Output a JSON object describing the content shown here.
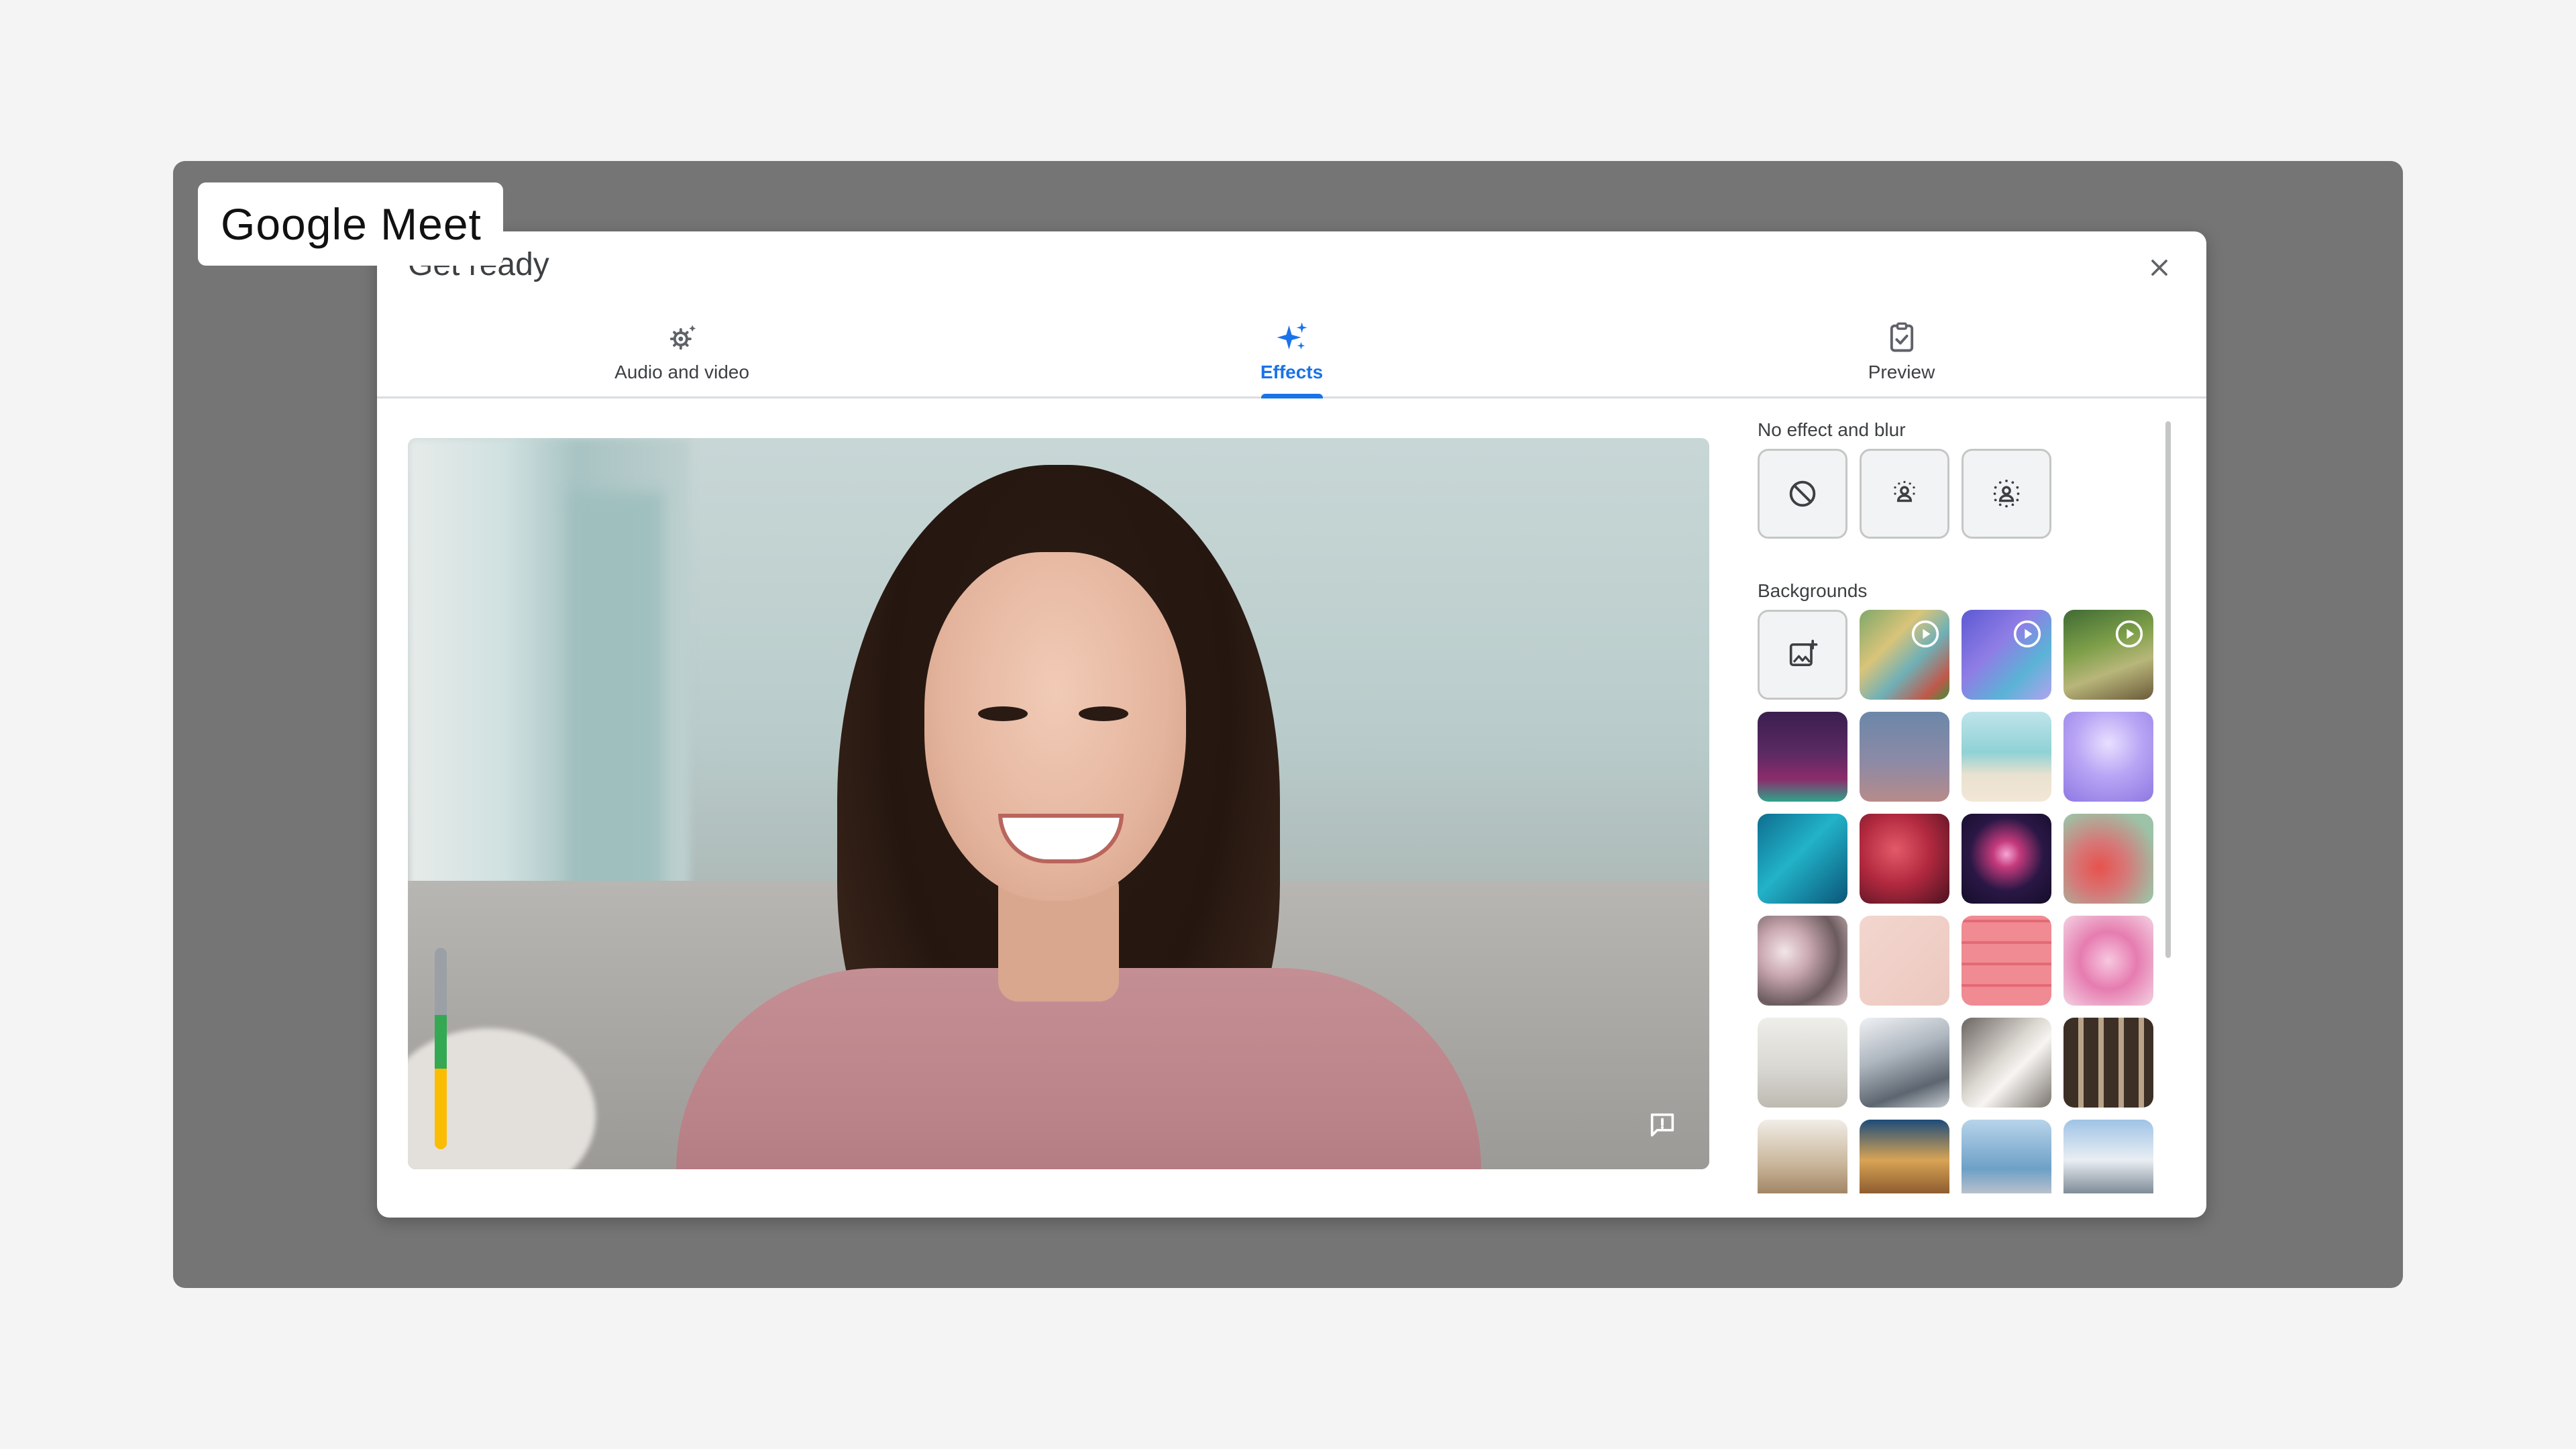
{
  "app_label": "Google Meet",
  "dialog": {
    "title": "Get ready",
    "close_icon": "close-icon"
  },
  "tabs": [
    {
      "label": "Audio and video",
      "icon": "audio-video-settings-icon",
      "active": false
    },
    {
      "label": "Effects",
      "icon": "sparkle-effects-icon",
      "active": true
    },
    {
      "label": "Preview",
      "icon": "clipboard-check-icon",
      "active": false
    }
  ],
  "panel": {
    "no_effect_title": "No effect and blur",
    "effects": [
      {
        "name": "no-effect",
        "icon": "no-effect-icon"
      },
      {
        "name": "slight-blur",
        "icon": "slight-blur-icon"
      },
      {
        "name": "blur",
        "icon": "blur-background-icon"
      }
    ],
    "backgrounds_title": "Backgrounds",
    "backgrounds": [
      {
        "name": "upload",
        "icon": "add-image-icon"
      },
      {
        "name": "animated-classroom",
        "video": true
      },
      {
        "name": "animated-purple-room",
        "video": true
      },
      {
        "name": "animated-forest",
        "video": true
      },
      {
        "name": "theater-stage"
      },
      {
        "name": "dusk-gradient"
      },
      {
        "name": "beach"
      },
      {
        "name": "purple-clouds"
      },
      {
        "name": "water"
      },
      {
        "name": "red-nebula"
      },
      {
        "name": "fireworks"
      },
      {
        "name": "flowers-red"
      },
      {
        "name": "flower-field"
      },
      {
        "name": "pink-confetti"
      },
      {
        "name": "pink-pattern"
      },
      {
        "name": "pink-blossom"
      },
      {
        "name": "white-room"
      },
      {
        "name": "glass-roof"
      },
      {
        "name": "bright-room"
      },
      {
        "name": "bookshelf"
      },
      {
        "name": "shelf-room"
      },
      {
        "name": "cafe"
      },
      {
        "name": "coast"
      },
      {
        "name": "mountains"
      }
    ]
  },
  "colors": {
    "accent": "#1a73e8",
    "mic_green": "#34a853",
    "mic_yellow": "#fbbc04"
  },
  "video": {
    "mic_level": 0.75,
    "feedback_icon": "feedback-icon"
  }
}
